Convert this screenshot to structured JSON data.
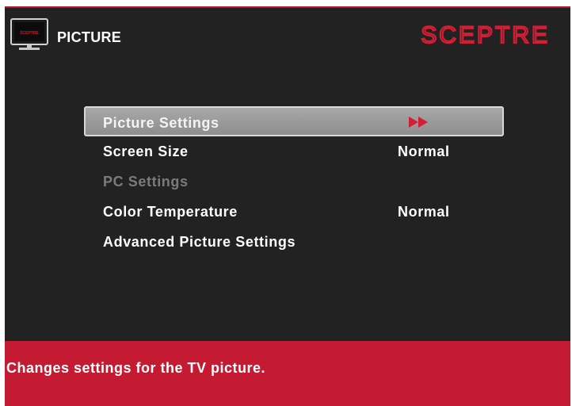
{
  "header": {
    "title": "PICTURE",
    "brand": "SCEPTRE",
    "icon": "tv-icon",
    "icon_screen_text": "SCEPTRE"
  },
  "menu": {
    "items": [
      {
        "label": "Picture Settings",
        "value": "",
        "state": "selected",
        "indicator": "double-arrow-right"
      },
      {
        "label": "Screen Size",
        "value": "Normal",
        "state": "enabled"
      },
      {
        "label": "PC Settings",
        "value": "",
        "state": "disabled"
      },
      {
        "label": "Color Temperature",
        "value": "Normal",
        "state": "enabled"
      },
      {
        "label": "Advanced Picture Settings",
        "value": "",
        "state": "enabled"
      }
    ]
  },
  "help": {
    "text": "Changes settings for the TV picture."
  },
  "colors": {
    "accent": "#c41a32",
    "background": "#222222",
    "selection": "#999999",
    "disabled_text": "#7b7b7b",
    "text": "#ffffff"
  }
}
